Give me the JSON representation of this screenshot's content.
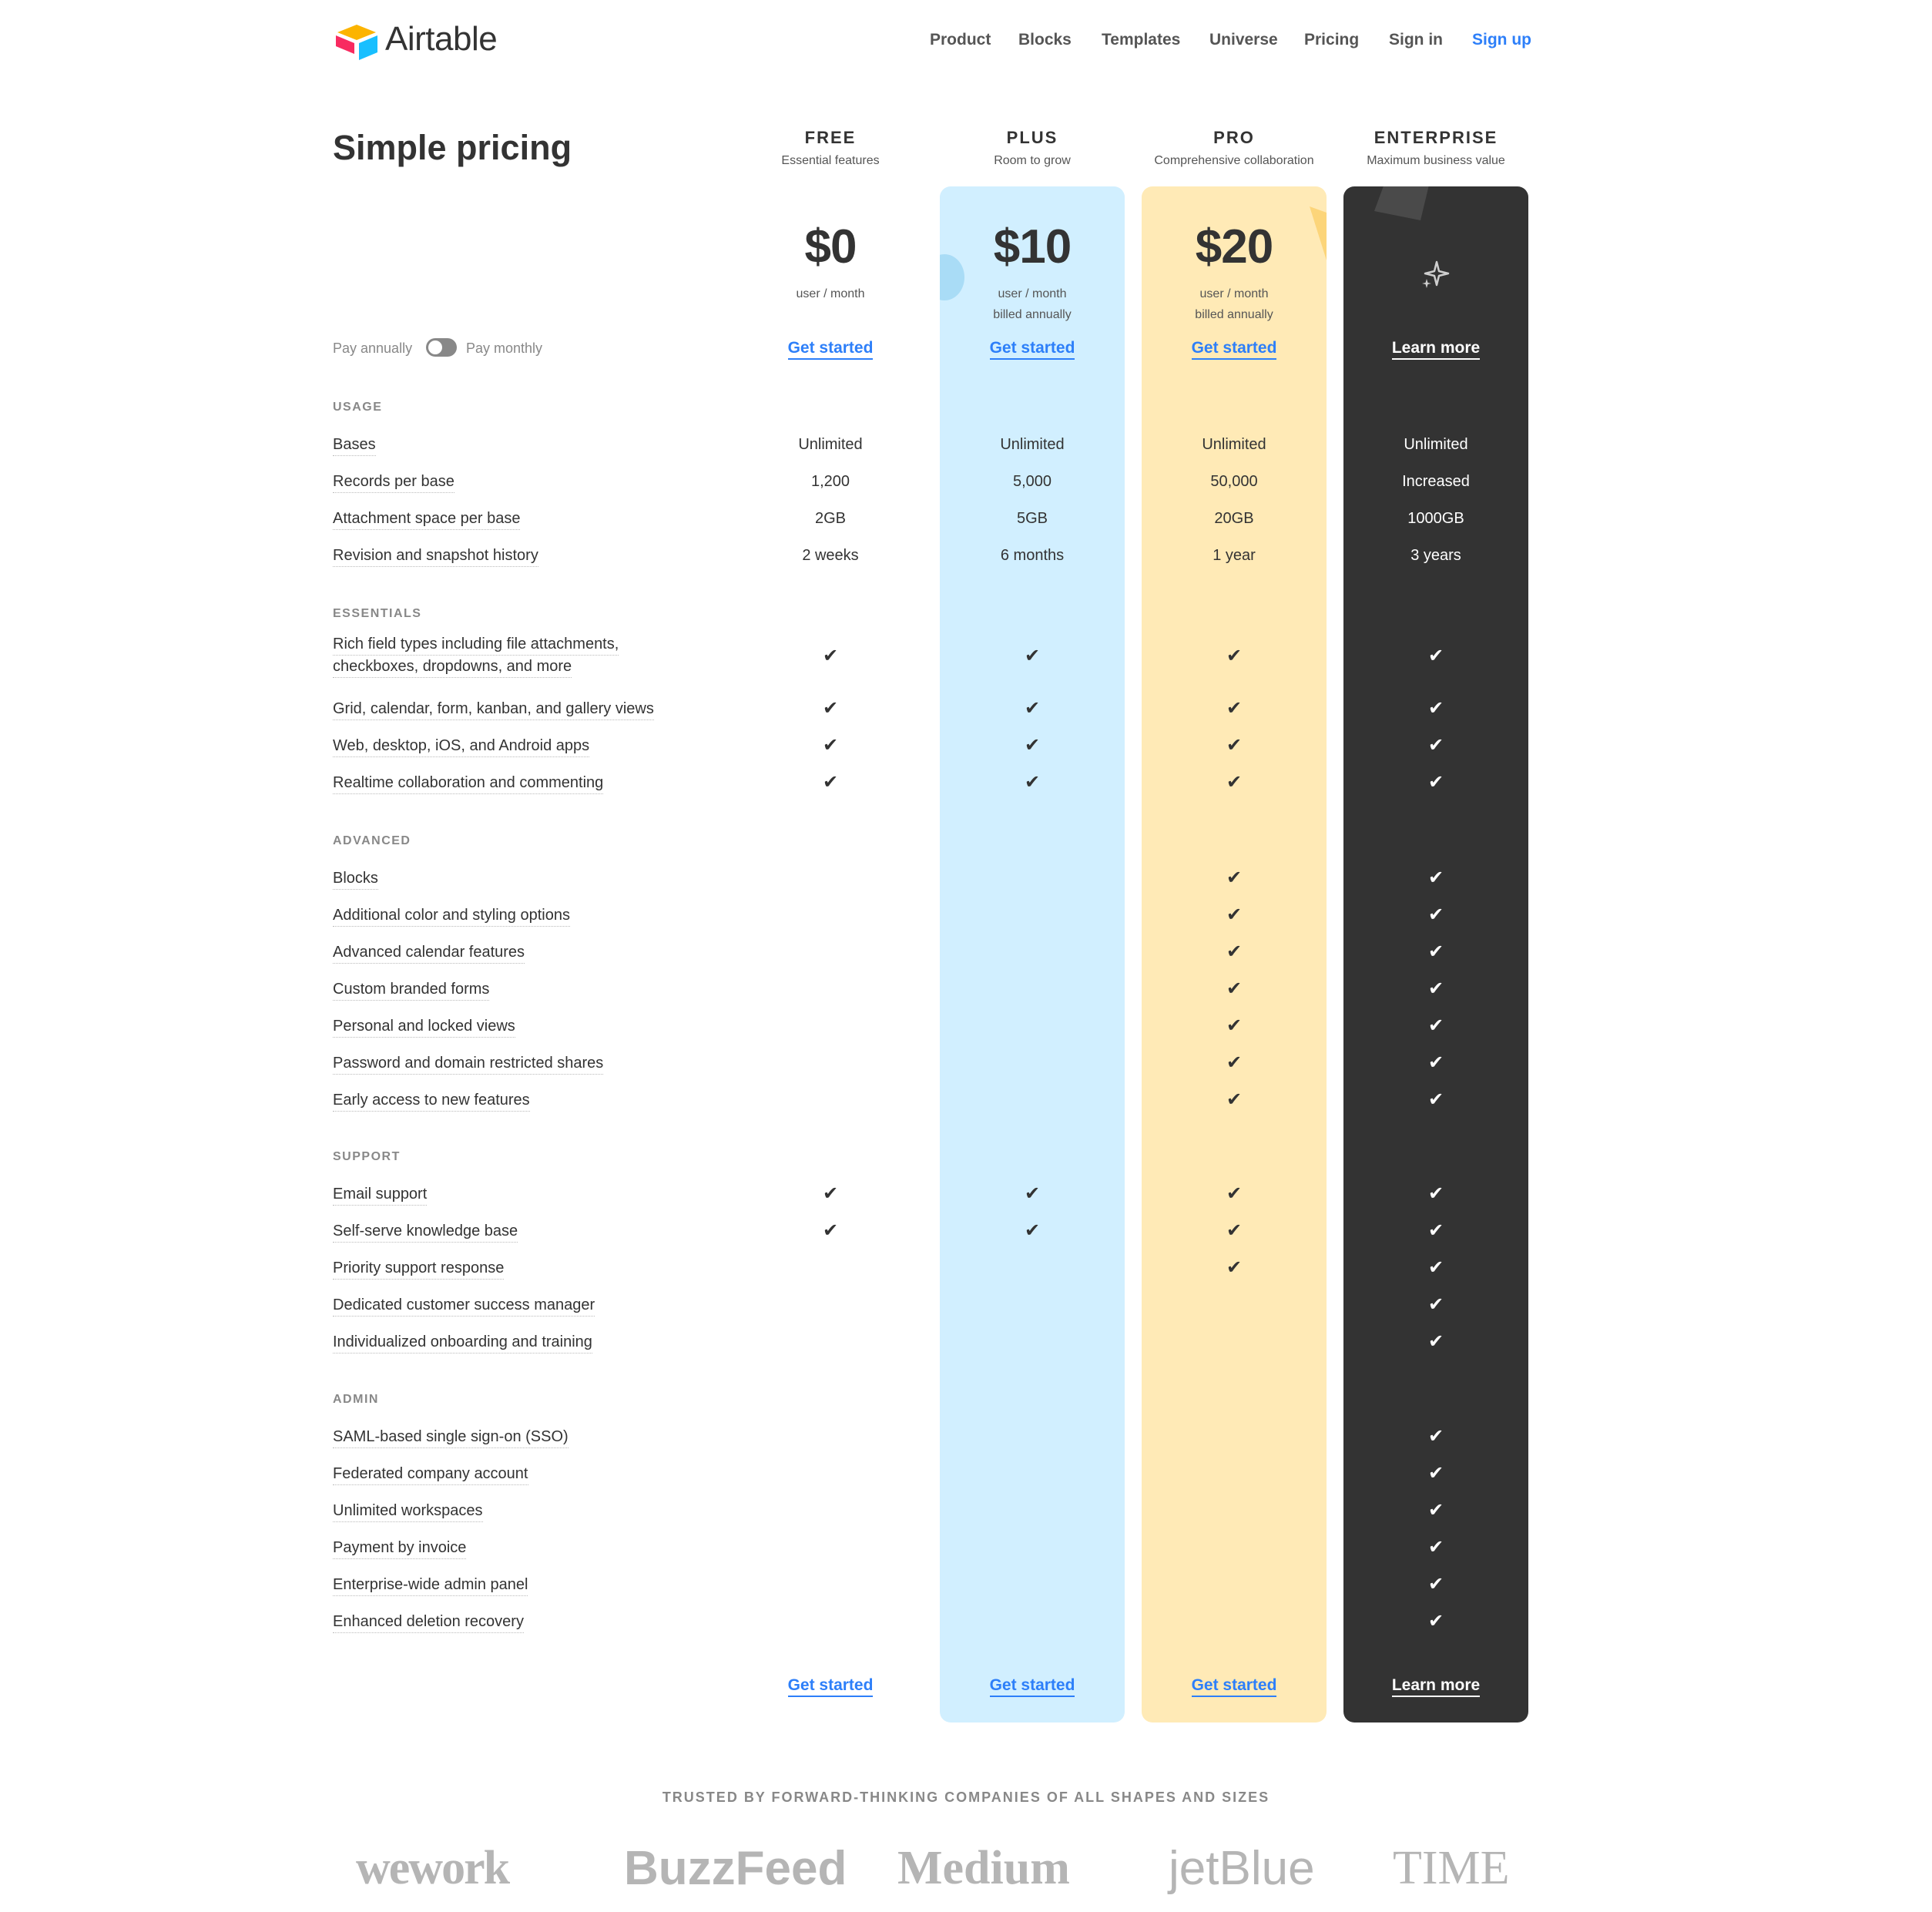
{
  "brand": {
    "name": "Airtable"
  },
  "nav": {
    "items": [
      "Product",
      "Blocks",
      "Templates",
      "Universe",
      "Pricing",
      "Sign in"
    ],
    "signup": "Sign up"
  },
  "page_title": "Simple pricing",
  "toggle": {
    "left": "Pay annually",
    "right": "Pay monthly"
  },
  "plans": [
    {
      "name": "FREE",
      "desc": "Essential features",
      "price": "$0",
      "unit": "user / month",
      "billing": "",
      "cta": "Get started",
      "cta_bottom": "Get started"
    },
    {
      "name": "PLUS",
      "desc": "Room to grow",
      "price": "$10",
      "unit": "user / month",
      "billing": "billed annually",
      "cta": "Get started",
      "cta_bottom": "Get started"
    },
    {
      "name": "PRO",
      "desc": "Comprehensive collaboration",
      "price": "$20",
      "unit": "user / month",
      "billing": "billed annually",
      "cta": "Get started",
      "cta_bottom": "Get started"
    },
    {
      "name": "ENTERPRISE",
      "desc": "Maximum business value",
      "price": "",
      "unit": "",
      "billing": "",
      "cta": "Learn more",
      "cta_bottom": "Learn more"
    }
  ],
  "check": "✔",
  "sections": {
    "usage": {
      "title": "USAGE",
      "rows": [
        {
          "label": "Bases",
          "values": [
            "Unlimited",
            "Unlimited",
            "Unlimited",
            "Unlimited"
          ]
        },
        {
          "label": "Records per base",
          "values": [
            "1,200",
            "5,000",
            "50,000",
            "Increased"
          ]
        },
        {
          "label": "Attachment space per base",
          "values": [
            "2GB",
            "5GB",
            "20GB",
            "1000GB"
          ]
        },
        {
          "label": "Revision and snapshot history",
          "values": [
            "2 weeks",
            "6 months",
            "1 year",
            "3 years"
          ]
        }
      ]
    },
    "essentials": {
      "title": "ESSENTIALS",
      "rows": [
        {
          "label_line1": "Rich field types including file attachments,",
          "label_line2": "checkboxes, dropdowns, and more",
          "checks": [
            true,
            true,
            true,
            true
          ]
        },
        {
          "label": "Grid, calendar, form, kanban, and gallery views",
          "checks": [
            true,
            true,
            true,
            true
          ]
        },
        {
          "label": "Web, desktop, iOS, and Android apps",
          "checks": [
            true,
            true,
            true,
            true
          ]
        },
        {
          "label": "Realtime collaboration and commenting",
          "checks": [
            true,
            true,
            true,
            true
          ]
        }
      ]
    },
    "advanced": {
      "title": "ADVANCED",
      "rows": [
        {
          "label": "Blocks",
          "checks": [
            false,
            false,
            true,
            true
          ]
        },
        {
          "label": "Additional color and styling options",
          "checks": [
            false,
            false,
            true,
            true
          ]
        },
        {
          "label": "Advanced calendar features",
          "checks": [
            false,
            false,
            true,
            true
          ]
        },
        {
          "label": "Custom branded forms",
          "checks": [
            false,
            false,
            true,
            true
          ]
        },
        {
          "label": "Personal and locked views",
          "checks": [
            false,
            false,
            true,
            true
          ]
        },
        {
          "label": "Password and domain restricted shares",
          "checks": [
            false,
            false,
            true,
            true
          ]
        },
        {
          "label": "Early access to new features",
          "checks": [
            false,
            false,
            true,
            true
          ]
        }
      ]
    },
    "support": {
      "title": "SUPPORT",
      "rows": [
        {
          "label": "Email support",
          "checks": [
            true,
            true,
            true,
            true
          ]
        },
        {
          "label": "Self-serve knowledge base",
          "checks": [
            true,
            true,
            true,
            true
          ]
        },
        {
          "label": "Priority support response",
          "checks": [
            false,
            false,
            true,
            true
          ]
        },
        {
          "label": "Dedicated customer success manager",
          "checks": [
            false,
            false,
            false,
            true
          ]
        },
        {
          "label": "Individualized onboarding and training",
          "checks": [
            false,
            false,
            false,
            true
          ]
        }
      ]
    },
    "admin": {
      "title": "ADMIN",
      "rows": [
        {
          "label": "SAML-based single sign-on (SSO)",
          "checks": [
            false,
            false,
            false,
            true
          ]
        },
        {
          "label": "Federated company account",
          "checks": [
            false,
            false,
            false,
            true
          ]
        },
        {
          "label": "Unlimited workspaces",
          "checks": [
            false,
            false,
            false,
            true
          ]
        },
        {
          "label": "Payment by invoice",
          "checks": [
            false,
            false,
            false,
            true
          ]
        },
        {
          "label": "Enterprise-wide admin panel",
          "checks": [
            false,
            false,
            false,
            true
          ]
        },
        {
          "label": "Enhanced deletion recovery",
          "checks": [
            false,
            false,
            false,
            true
          ]
        }
      ]
    }
  },
  "trusted": {
    "title": "TRUSTED BY FORWARD-THINKING COMPANIES OF ALL SHAPES AND SIZES",
    "logos": [
      "wework",
      "BuzzFeed",
      "Medium",
      "jetBlue",
      "TIME"
    ]
  },
  "colors": {
    "accent": "#2d7ff9",
    "plus_bg": "#d1efff",
    "pro_bg": "#ffeab6",
    "enterprise_bg": "#333333"
  },
  "icons": [
    "airtable-logo-icon",
    "check-icon",
    "sparkle-icon"
  ]
}
